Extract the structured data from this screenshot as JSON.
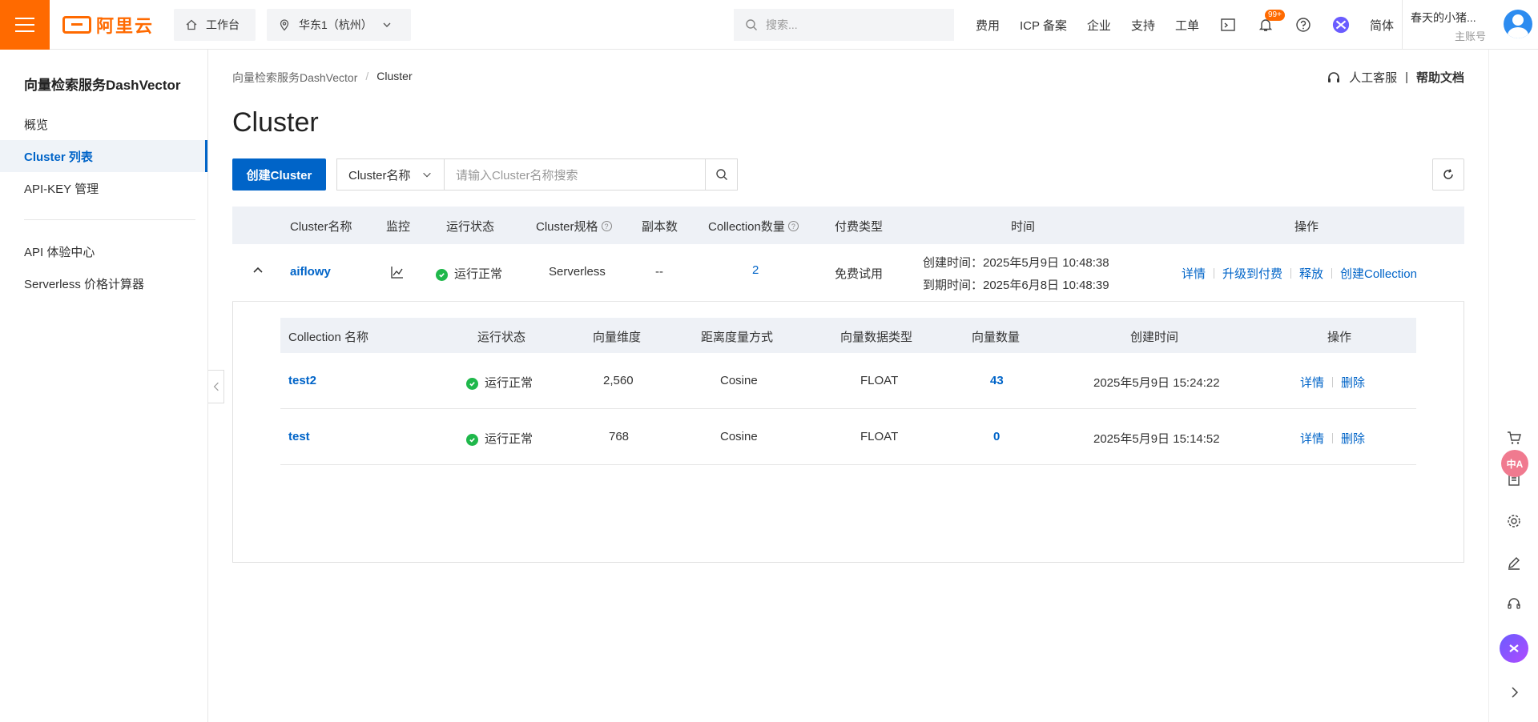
{
  "topbar": {
    "logo_text": "阿里云",
    "workbench": "工作台",
    "region": "华东1（杭州）",
    "search_placeholder": "搜索...",
    "links": [
      "费用",
      "ICP 备案",
      "企业",
      "支持",
      "工单"
    ],
    "badge": "99+",
    "language": "简体",
    "user_name": "春天的小猪...",
    "user_role": "主账号"
  },
  "sidebar": {
    "title": "向量检索服务DashVector",
    "items": [
      {
        "label": "概览",
        "active": false
      },
      {
        "label": "Cluster 列表",
        "active": true
      },
      {
        "label": "API-KEY 管理",
        "active": false
      }
    ],
    "items2": [
      {
        "label": "API 体验中心"
      },
      {
        "label": "Serverless 价格计算器"
      }
    ]
  },
  "breadcrumb": [
    "向量检索服务DashVector",
    "Cluster"
  ],
  "help": {
    "service": "人工客服",
    "docs": "帮助文档"
  },
  "page_title": "Cluster",
  "toolbar": {
    "create_label": "创建Cluster",
    "filter_select": "Cluster名称",
    "filter_placeholder": "请输入Cluster名称搜索"
  },
  "cluster_table": {
    "headers": {
      "name": "Cluster名称",
      "monitor": "监控",
      "status": "运行状态",
      "spec": "Cluster规格",
      "replicas": "副本数",
      "collections": "Collection数量",
      "billing": "付费类型",
      "time": "时间",
      "ops": "操作"
    },
    "row": {
      "name": "aiflowy",
      "status": "运行正常",
      "spec": "Serverless",
      "replicas": "--",
      "collections": "2",
      "billing": "免费试用",
      "created": "创建时间：2025年5月9日 10:48:38",
      "expires": "到期时间：2025年6月8日 10:48:39",
      "ops": [
        "详情",
        "升级到付费",
        "释放",
        "创建Collection"
      ]
    }
  },
  "collection_table": {
    "headers": {
      "name": "Collection 名称",
      "status": "运行状态",
      "dim": "向量维度",
      "metric": "距离度量方式",
      "dtype": "向量数据类型",
      "count": "向量数量",
      "created": "创建时间",
      "ops": "操作"
    },
    "rows": [
      {
        "name": "test2",
        "status": "运行正常",
        "dim": "2,560",
        "metric": "Cosine",
        "dtype": "FLOAT",
        "count": "43",
        "created": "2025年5月9日 15:24:22",
        "op1": "详情",
        "op2": "删除"
      },
      {
        "name": "test",
        "status": "运行正常",
        "dim": "768",
        "metric": "Cosine",
        "dtype": "FLOAT",
        "count": "0",
        "created": "2025年5月9日 15:14:52",
        "op1": "详情",
        "op2": "删除"
      }
    ]
  },
  "float_translate": "中A",
  "colors": {
    "brand": "#ff6a00",
    "primary": "#0064c8",
    "success": "#1fb84b"
  }
}
